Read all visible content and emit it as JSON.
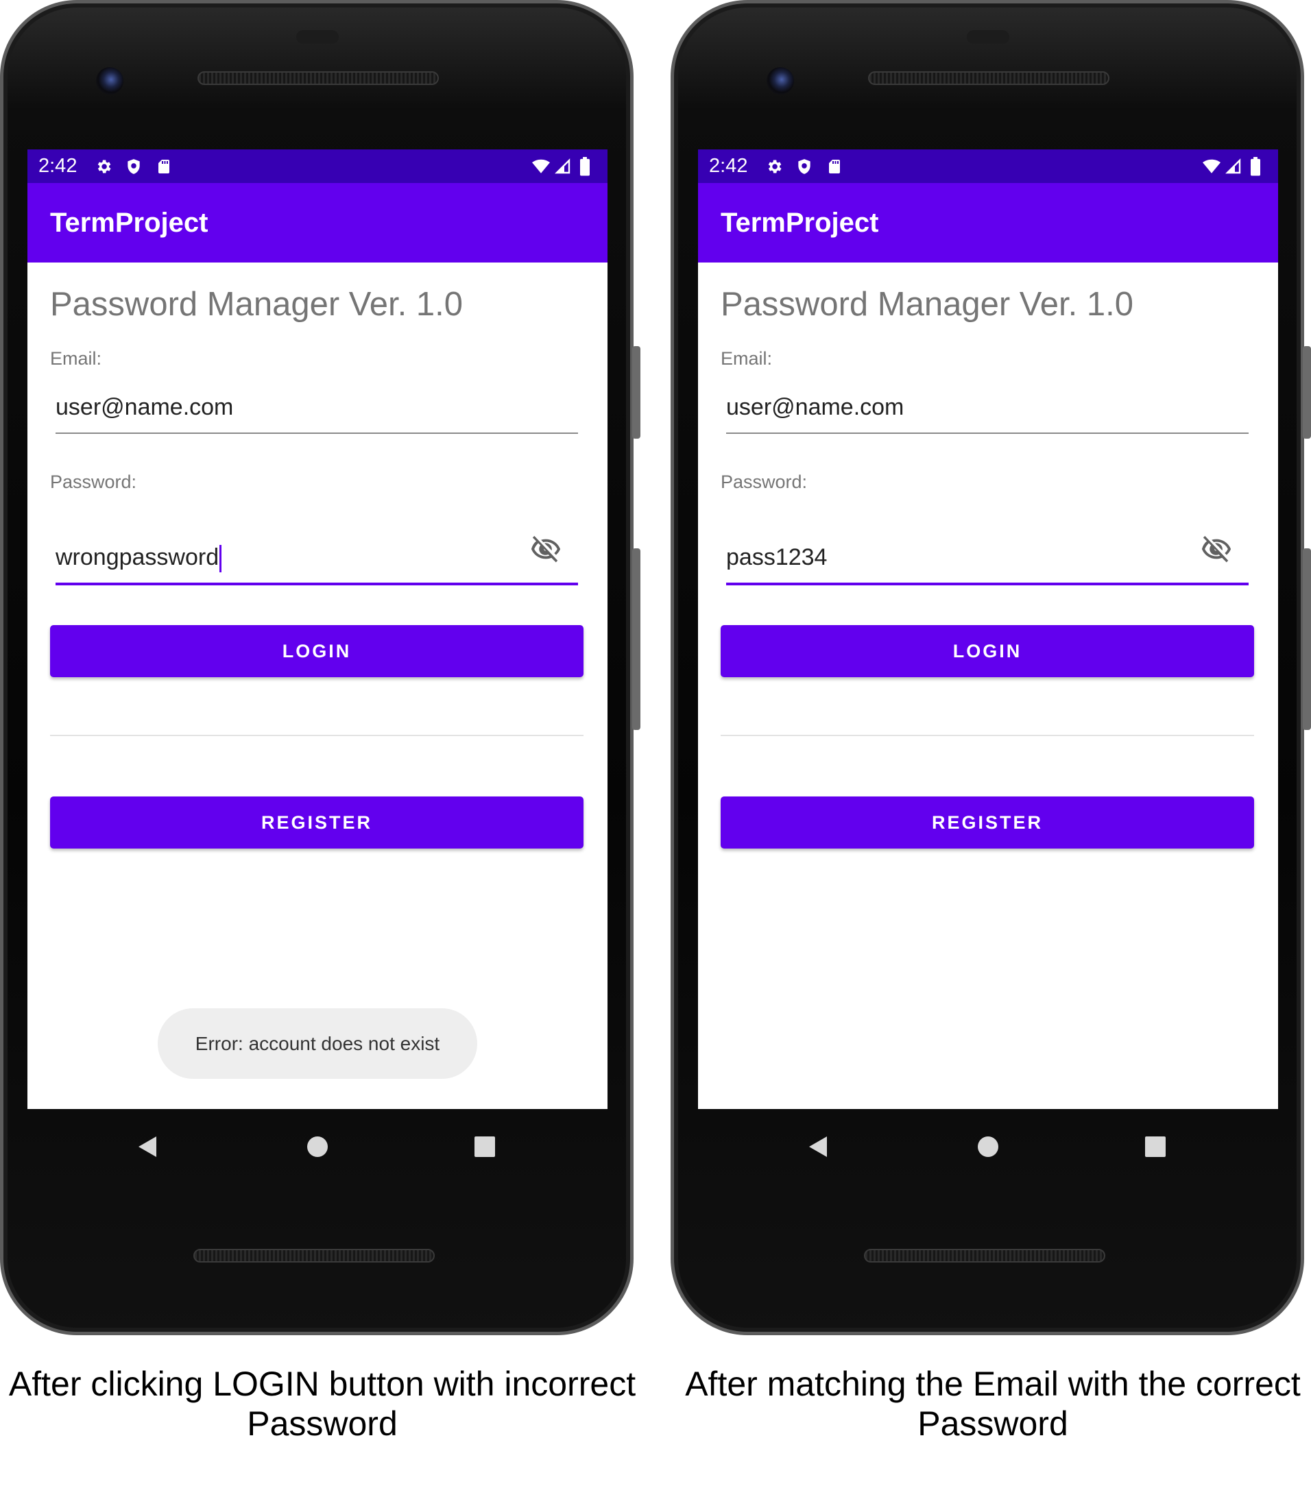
{
  "left": {
    "status_time": "2:42",
    "app_title": "TermProject",
    "heading": "Password Manager Ver. 1.0",
    "email_label": "Email:",
    "email_value": "user@name.com",
    "password_label": "Password:",
    "password_value": "wrongpassword",
    "login_label": "LOGIN",
    "register_label": "REGISTER",
    "toast": "Error: account does not exist",
    "caption": "After clicking LOGIN button with incorrect Password"
  },
  "right": {
    "status_time": "2:42",
    "app_title": "TermProject",
    "heading": "Password Manager Ver. 1.0",
    "email_label": "Email:",
    "email_value": "user@name.com",
    "password_label": "Password:",
    "password_value": "pass1234",
    "login_label": "LOGIN",
    "register_label": "REGISTER",
    "caption": "After matching the Email with the correct Password"
  },
  "icons": {
    "status_left": [
      "gear-icon",
      "shield-icon",
      "sd-card-icon"
    ],
    "status_right": [
      "wifi-icon",
      "signal-icon",
      "battery-icon"
    ],
    "password_toggle": "eye-off-icon",
    "nav": [
      "back-icon",
      "home-icon",
      "recents-icon"
    ]
  },
  "colors": {
    "status_bar": "#3700b3",
    "app_bar": "#6200ee",
    "primary": "#6200ee",
    "toast_bg": "#eeeeee"
  }
}
